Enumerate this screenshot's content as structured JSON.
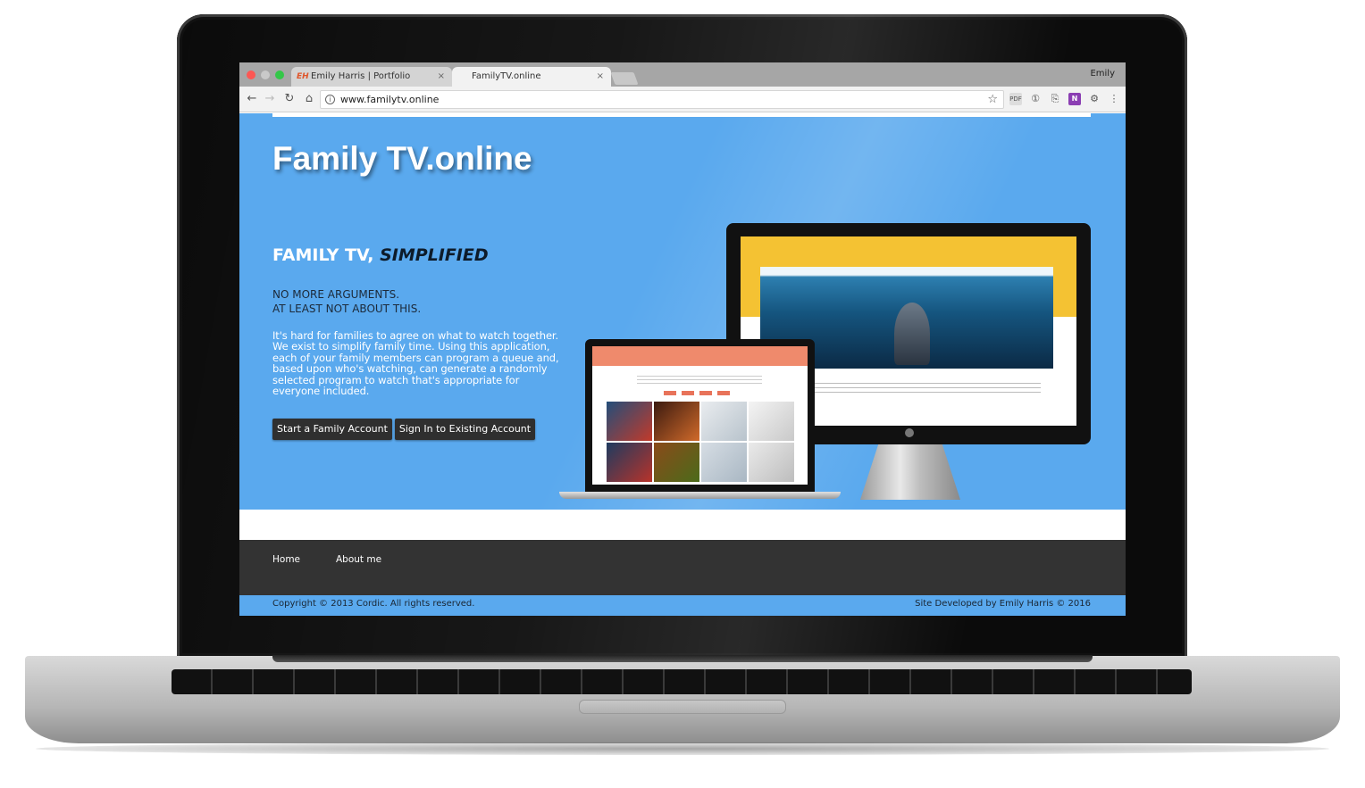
{
  "browser": {
    "profile_name": "Emily",
    "tabs": [
      {
        "favicon": "EH",
        "label": "Emily Harris | Portfolio",
        "close": "×"
      },
      {
        "favicon": "▯",
        "label": "FamilyTV.online",
        "close": "×"
      }
    ],
    "url": "www.familytv.online",
    "icons": {
      "back": "←",
      "forward": "→",
      "reload": "↻",
      "home": "⌂",
      "info": "i",
      "star": "☆",
      "ext_1": "PDF",
      "ext_2": "①",
      "ext_3": "⎘",
      "ext_4": "N",
      "ext_5": "⚙",
      "ext_6": "⋮"
    }
  },
  "site": {
    "title": "Family TV.online",
    "tagline_main": "FAMILY TV, ",
    "tagline_em": "SIMPLIFIED",
    "subhead_line1": "NO MORE ARGUMENTS.",
    "subhead_line2": "AT LEAST NOT ABOUT THIS.",
    "description": "It's hard for families to agree on what to watch together. We exist to simplify family time. Using this application, each of your family members can program a queue and, based upon who's watching, can generate a randomly selected program to watch that's appropriate for everyone included.",
    "buttons": {
      "start": "Start a Family Account",
      "signin": "Sign In to Existing Account"
    },
    "footer": {
      "links": [
        "Home",
        "About me"
      ],
      "copyright": "Copyright © 2013 Cordic. All rights reserved.",
      "credit": "Site Developed by Emily Harris © 2016"
    }
  },
  "colors": {
    "hero_blue": "#5aa9ee",
    "footer_dark": "#333333",
    "button_dark": "#2f2f2f",
    "monitor_yellow": "#f4c233",
    "mini_salmon": "#ef8a6c"
  }
}
